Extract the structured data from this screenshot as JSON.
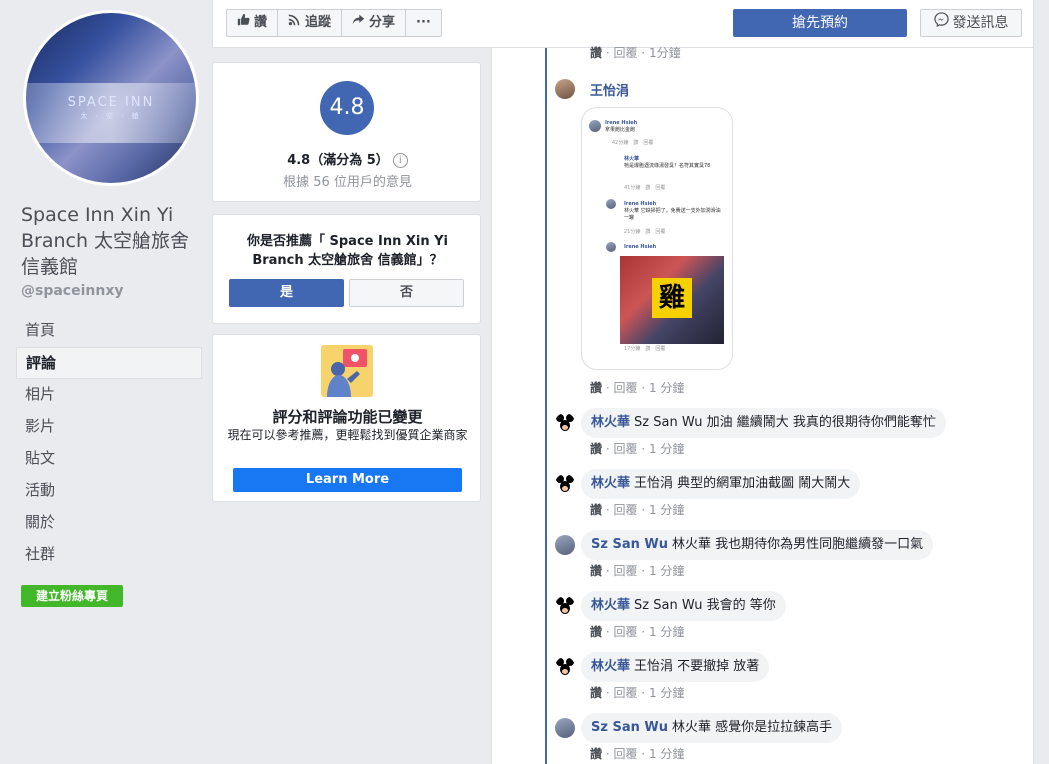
{
  "page": {
    "name": "Space Inn Xin Yi Branch 太空艙旅舍 信義館",
    "handle": "@spaceinnxy",
    "avatar_logo": "SPACE INN",
    "avatar_sub": "太 · 空 · 艙"
  },
  "nav": [
    "首頁",
    "評論",
    "相片",
    "影片",
    "貼文",
    "活動",
    "關於",
    "社群"
  ],
  "nav_active": "評論",
  "create_button": "建立粉絲專頁",
  "actionbar": {
    "like": "讚",
    "follow": "追蹤",
    "share": "分享",
    "more": "···",
    "primary": "搶先預約",
    "message": "發送訊息"
  },
  "rating": {
    "score": "4.8",
    "text": "4.8（滿分為 5）",
    "sub": "根據 56 位用戶的意見"
  },
  "recommend": {
    "question": "你是否推薦「 Space Inn Xin Yi Branch 太空艙旅舍 信義館」？",
    "yes": "是",
    "no": "否"
  },
  "notice": {
    "title": "評分和評論功能已變更",
    "body": "現在可以參考推薦，更輕鬆找到優質企業商家",
    "button": "Learn More"
  },
  "actions": {
    "like": "讚",
    "reply": "回覆",
    "time": "1 分鐘",
    "time_top": "1分鐘"
  },
  "image_comment": {
    "author": "王怡涓",
    "screenshot": {
      "r1_name": "Irene Hsieh",
      "r1_text": "拿果飽比金飽",
      "r1_meta": "42分鐘　讚　回覆",
      "r2_name": "林火華",
      "r2_text": "牠是爆胞遇流綠湯發臭！名符其實臭78",
      "r2_meta": "41分鐘　讚　回覆",
      "r3_name": "Irene Hsieh",
      "r3_text": "林火華 它缺掃把了，免費送一支外加潤滑油一罐",
      "r3_meta": "21分鐘　讚　回覆",
      "r4_name": "Irene Hsieh",
      "r4_meta": "17分鐘　讚　回覆",
      "sticker_text": "雞"
    }
  },
  "comments": [
    {
      "author": "林火華",
      "text": "Sz San Wu 加油 繼續鬧大 我真的很期待你們能奪忙",
      "avatar": "mickey"
    },
    {
      "author": "林火華",
      "text": "王怡涓 典型的網軍加油截圖 鬧大鬧大",
      "avatar": "mickey"
    },
    {
      "author": "Sz San Wu",
      "text": "林火華 我也期待你為男性同胞繼續發一口氣",
      "avatar": "person"
    },
    {
      "author": "林火華",
      "text": "Sz San Wu 我會的 等你",
      "avatar": "mickey"
    },
    {
      "author": "林火華",
      "text": "王怡涓 不要撤掉 放著",
      "avatar": "mickey"
    },
    {
      "author": "Sz San Wu",
      "text": "林火華 感覺你是拉拉鍊高手",
      "avatar": "person"
    }
  ],
  "colors": {
    "accent": "#4267b2",
    "link": "#385898",
    "green": "#42b72a",
    "learn": "#1877f2"
  }
}
